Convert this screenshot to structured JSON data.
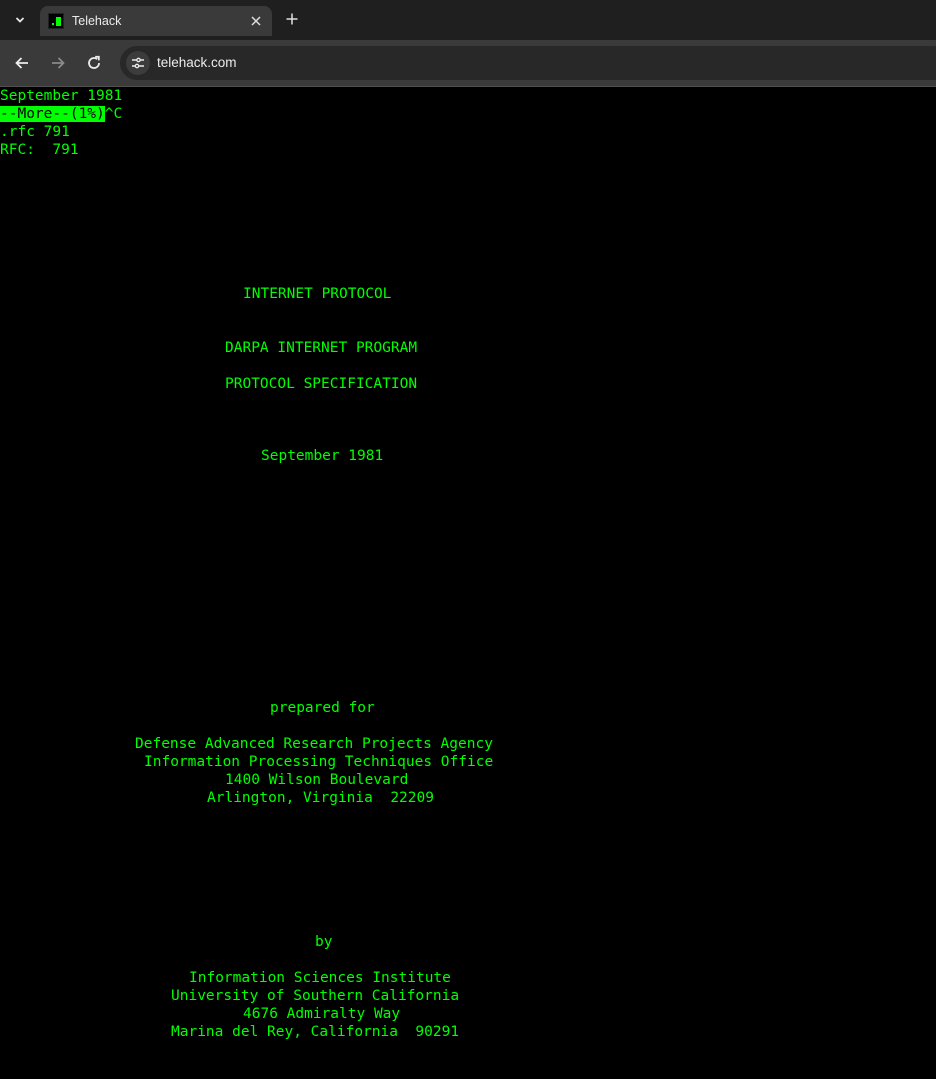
{
  "browser": {
    "tab": {
      "title": "Telehack"
    },
    "address_bar": {
      "url": "telehack.com"
    }
  },
  "terminal": {
    "header_lines": {
      "date": "September 1981",
      "more_prompt": "--More--(1%)",
      "interrupt": "^C",
      "command": ".rfc 791",
      "rfc": "RFC:  791"
    },
    "document": {
      "title": "INTERNET PROTOCOL",
      "program": "DARPA INTERNET PROGRAM",
      "spec": "PROTOCOL SPECIFICATION",
      "date": "September 1981",
      "prepared_for": "prepared for",
      "agency": [
        "Defense Advanced Research Projects Agency",
        "Information Processing Techniques Office",
        "1400 Wilson Boulevard",
        "Arlington, Virginia  22209"
      ],
      "by": "by",
      "author": [
        "Information Sciences Institute",
        "University of Southern California",
        "4676 Admiralty Way",
        "Marina del Rey, California  90291"
      ]
    }
  },
  "colors": {
    "terminal_text": "#00ff00",
    "terminal_bg": "#000000"
  }
}
